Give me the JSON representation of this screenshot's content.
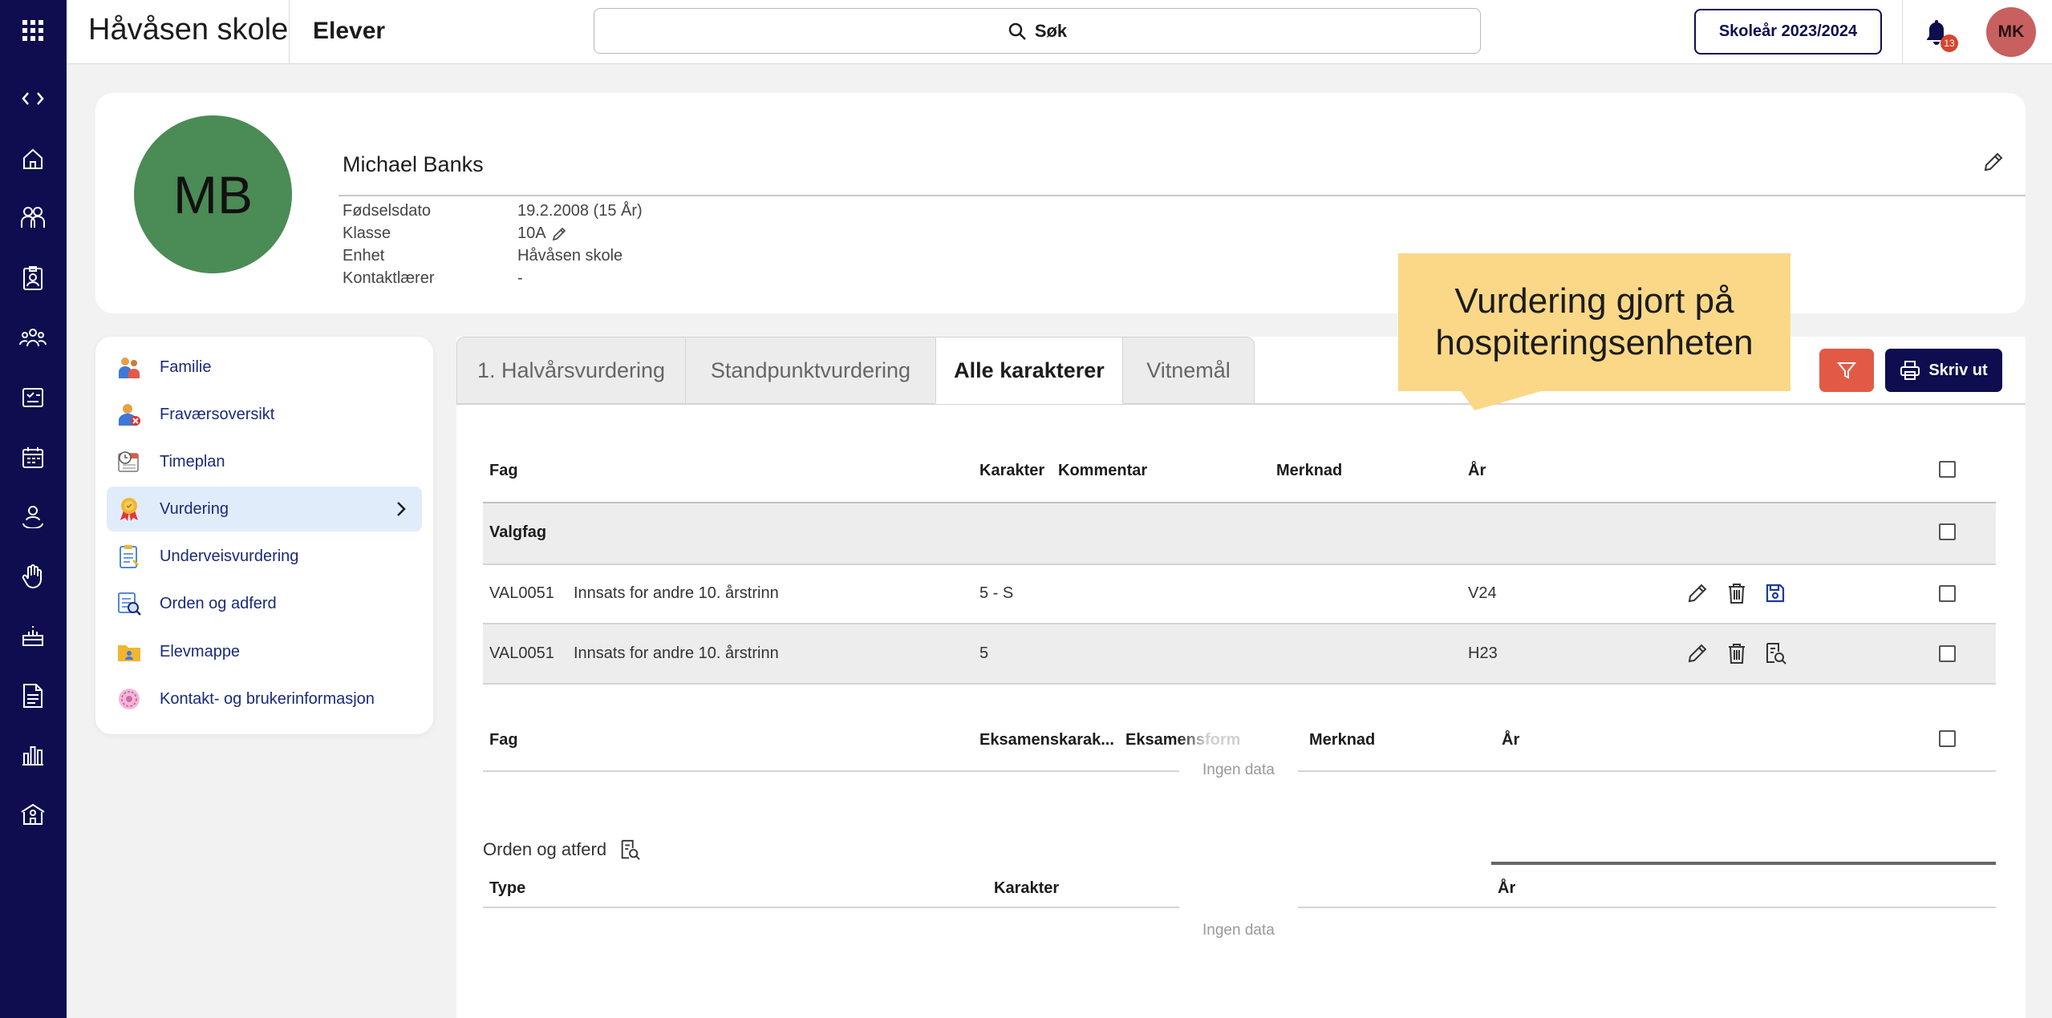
{
  "topbar": {
    "school": "Håvåsen skole",
    "title": "Elever",
    "search_label": "Søk",
    "year_button": "Skoleår 2023/2024",
    "notification_count": "13",
    "user_initials": "MK"
  },
  "rail": {
    "icons": [
      "collapse-expand-icon",
      "home-icon",
      "students-icon",
      "badge-icon",
      "groups-icon",
      "assessment-icon",
      "calendar-icon",
      "person-icon",
      "hand-icon",
      "cake-icon",
      "document-icon",
      "chart-icon",
      "school-icon"
    ]
  },
  "profile": {
    "initials": "MB",
    "name": "Michael Banks",
    "fields": [
      {
        "label": "Fødselsdato",
        "value": "19.2.2008 (15 År)"
      },
      {
        "label": "Klasse",
        "value": "10A"
      },
      {
        "label": "Enhet",
        "value": "Håvåsen skole"
      },
      {
        "label": "Kontaktlærer",
        "value": "-"
      }
    ]
  },
  "sidemenu": {
    "items": [
      {
        "label": "Familie",
        "icon": "family-icon"
      },
      {
        "label": "Fraværsoversikt",
        "icon": "absence-icon"
      },
      {
        "label": "Timeplan",
        "icon": "timetable-icon"
      },
      {
        "label": "Vurdering",
        "icon": "medal-icon",
        "active": true
      },
      {
        "label": "Underveisvurdering",
        "icon": "clipboard-icon"
      },
      {
        "label": "Orden og adferd",
        "icon": "conduct-icon"
      },
      {
        "label": "Elevmappe",
        "icon": "folder-icon"
      },
      {
        "label": "Kontakt- og brukerinformasjon",
        "icon": "contact-icon"
      }
    ]
  },
  "tabs": [
    {
      "label": "1. Halvårsvurdering"
    },
    {
      "label": "Standpunktvurdering"
    },
    {
      "label": "Alle karakterer",
      "active": true
    },
    {
      "label": "Vitnemål"
    }
  ],
  "callout": {
    "line1": "Vurdering gjort på",
    "line2": "hospiteringsenheten"
  },
  "toolbar": {
    "print_label": "Skriv ut"
  },
  "grades": {
    "headers": {
      "fag": "Fag",
      "karakter": "Karakter",
      "kommentar": "Kommentar",
      "merknad": "Merknad",
      "ar": "År"
    },
    "group": "Valgfag",
    "rows": [
      {
        "code": "VAL0051",
        "subject": "Innsats for andre 10. årstrinn",
        "grade": "5 - S",
        "year": "V24"
      },
      {
        "code": "VAL0051",
        "subject": "Innsats for andre 10. årstrinn",
        "grade": "5",
        "year": "H23"
      }
    ]
  },
  "exams": {
    "headers": {
      "fag": "Fag",
      "eksamenskarakter": "Eksamenskarak...",
      "eksamensform": "Eksamensform",
      "merknad": "Merknad",
      "ar": "År"
    },
    "empty": "Ingen data"
  },
  "conduct": {
    "title": "Orden og atferd",
    "headers": {
      "type": "Type",
      "karakter": "Karakter",
      "ar": "År"
    },
    "empty": "Ingen data"
  },
  "colors": {
    "navy": "#0d0d4f",
    "filter": "#e25a45",
    "callout": "#fad888",
    "avatar": "#4b8b55",
    "user_avatar": "#c86060"
  }
}
